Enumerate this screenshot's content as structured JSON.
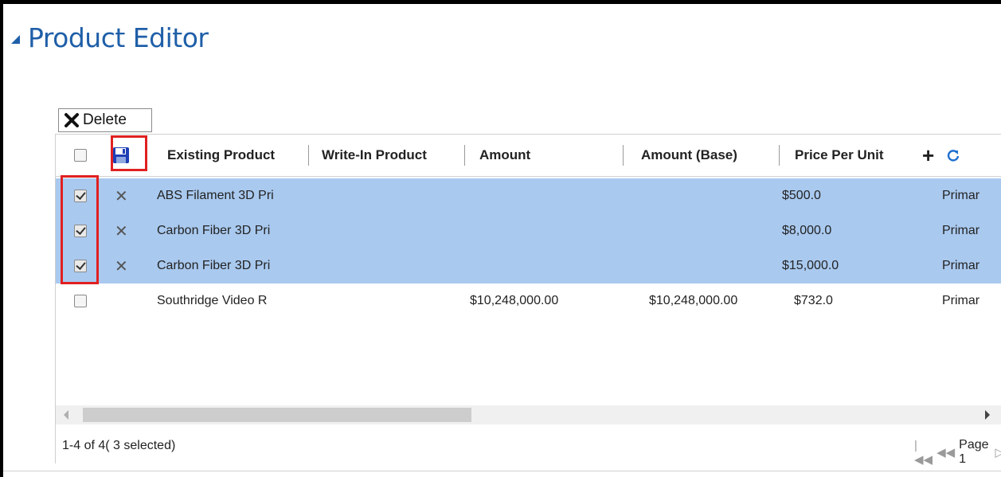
{
  "section": {
    "title": "Product Editor"
  },
  "toolbar": {
    "delete_label": "Delete"
  },
  "columns": {
    "existing_product": "Existing Product",
    "write_in_product": "Write-In Product",
    "amount": "Amount",
    "amount_base": "Amount (Base)",
    "price_per_unit": "Price Per Unit"
  },
  "rows": [
    {
      "selected": true,
      "product": "ABS Filament 3D Pri",
      "amount": "",
      "amount_base": "",
      "price": "$500.0",
      "extra": "Primar"
    },
    {
      "selected": true,
      "product": "Carbon Fiber 3D Pri",
      "amount": "",
      "amount_base": "",
      "price": "$8,000.0",
      "extra": "Primar"
    },
    {
      "selected": true,
      "product": "Carbon Fiber 3D Pri",
      "amount": "",
      "amount_base": "",
      "price": "$15,000.0",
      "extra": "Primar"
    },
    {
      "selected": false,
      "product": "Southridge Video R",
      "amount": "$10,248,000.00",
      "amount_base": "$10,248,000.00",
      "price": "$732.0",
      "extra": "Primar"
    }
  ],
  "footer": {
    "status": "1-4 of 4( 3 selected)",
    "page_label": "Page 1"
  },
  "colors": {
    "title": "#1f5fa8",
    "selection": "#a9c9ef",
    "highlight": "#e02020",
    "save_icon": "#1e40b5"
  },
  "icons": [
    "collapse-icon",
    "delete-x-icon",
    "save-icon",
    "add-icon",
    "refresh-icon",
    "first-page-icon",
    "prev-page-icon",
    "next-page-icon"
  ]
}
